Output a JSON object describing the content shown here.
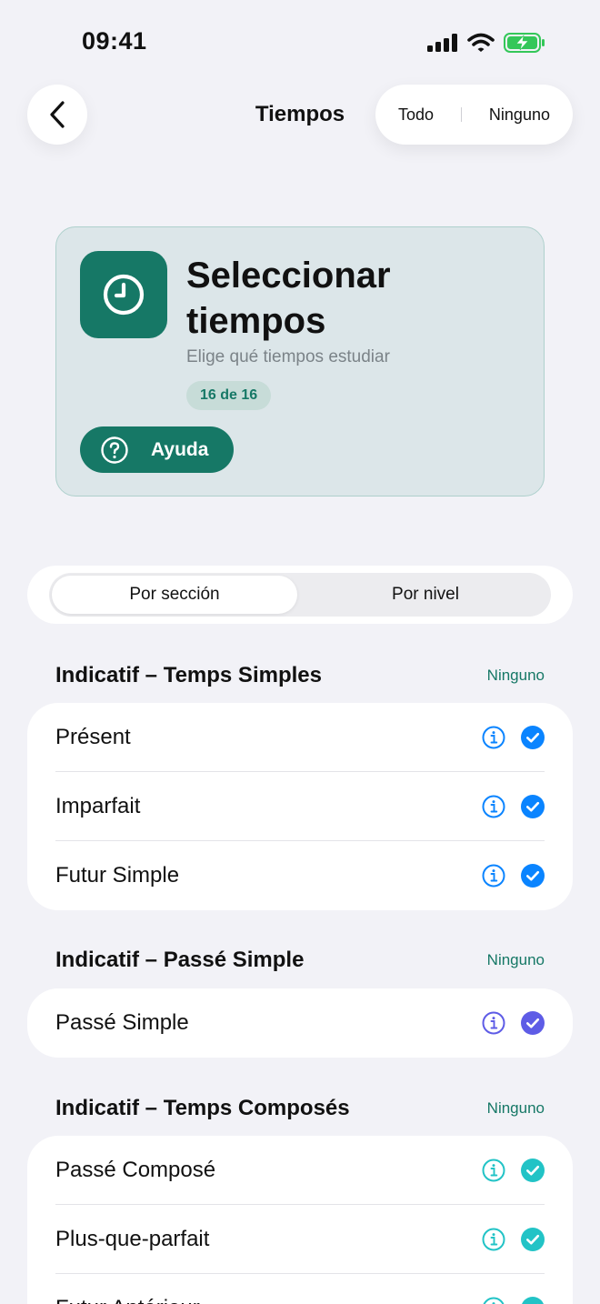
{
  "status_bar": {
    "time": "09:41"
  },
  "nav": {
    "title": "Tiempos",
    "all_label": "Todo",
    "none_label": "Ninguno"
  },
  "hero": {
    "icon": "clock-icon",
    "title": "Seleccionar tiempos",
    "subtitle": "Elige qué tiempos estudiar",
    "badge": "16 de 16",
    "help_label": "Ayuda",
    "accent": "#167866"
  },
  "segments": {
    "by_section": "Por sección",
    "by_level": "Por nivel",
    "selected": "Por sección"
  },
  "sections": [
    {
      "title": "Indicatif – Temps Simples",
      "action": "Ninguno",
      "color": "#0a84ff",
      "items": [
        {
          "label": "Présent",
          "checked": true
        },
        {
          "label": "Imparfait",
          "checked": true
        },
        {
          "label": "Futur Simple",
          "checked": true
        }
      ]
    },
    {
      "title": "Indicatif – Passé Simple",
      "action": "Ninguno",
      "color": "#5e5ce6",
      "items": [
        {
          "label": "Passé Simple",
          "checked": true
        }
      ]
    },
    {
      "title": "Indicatif – Temps Composés",
      "action": "Ninguno",
      "color": "#22c3c6",
      "items": [
        {
          "label": "Passé Composé",
          "checked": true
        },
        {
          "label": "Plus-que-parfait",
          "checked": true
        },
        {
          "label": "Futur Antérieur",
          "checked": true
        }
      ]
    }
  ]
}
